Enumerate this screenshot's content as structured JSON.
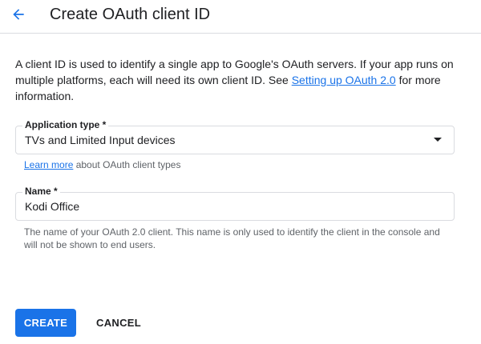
{
  "header": {
    "title": "Create OAuth client ID",
    "back_icon": "arrow-back-icon"
  },
  "intro": {
    "text_before": "A client ID is used to identify a single app to Google's OAuth servers. If your app runs on multiple platforms, each will need its own client ID. See ",
    "link_text": "Setting up OAuth 2.0",
    "text_after": " for more information."
  },
  "application_type": {
    "label": "Application type *",
    "value": "TVs and Limited Input devices",
    "helper_link": "Learn more",
    "helper_text": " about OAuth client types"
  },
  "name_field": {
    "label": "Name *",
    "value": "Kodi Office",
    "helper": "The name of your OAuth 2.0 client. This name is only used to identify the client in the console and will not be shown to end users."
  },
  "actions": {
    "create_label": "CREATE",
    "cancel_label": "CANCEL"
  },
  "colors": {
    "accent": "#1a73e8",
    "text": "#202124",
    "muted": "#5f6368",
    "border": "#dadce0"
  }
}
